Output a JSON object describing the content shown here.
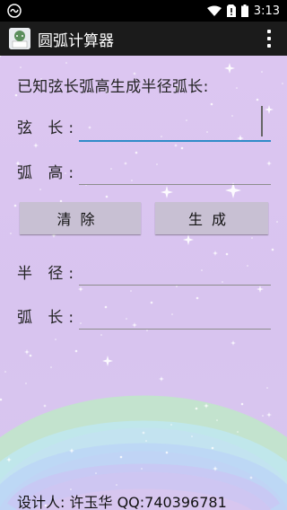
{
  "status_bar": {
    "time": "3:13"
  },
  "app_bar": {
    "title": "圆弧计算器"
  },
  "form": {
    "heading": "已知弦长弧高生成半径弧长:",
    "chord_label": "弦 长:",
    "chord_value": "",
    "height_label": "弧 高:",
    "height_value": "",
    "radius_label": "半 径:",
    "radius_value": "",
    "arc_label": "弧 长:",
    "arc_value": ""
  },
  "buttons": {
    "clear": "清除",
    "generate": "生成"
  },
  "footer": {
    "designer": "设计人:  许玉华 QQ:740396781"
  }
}
